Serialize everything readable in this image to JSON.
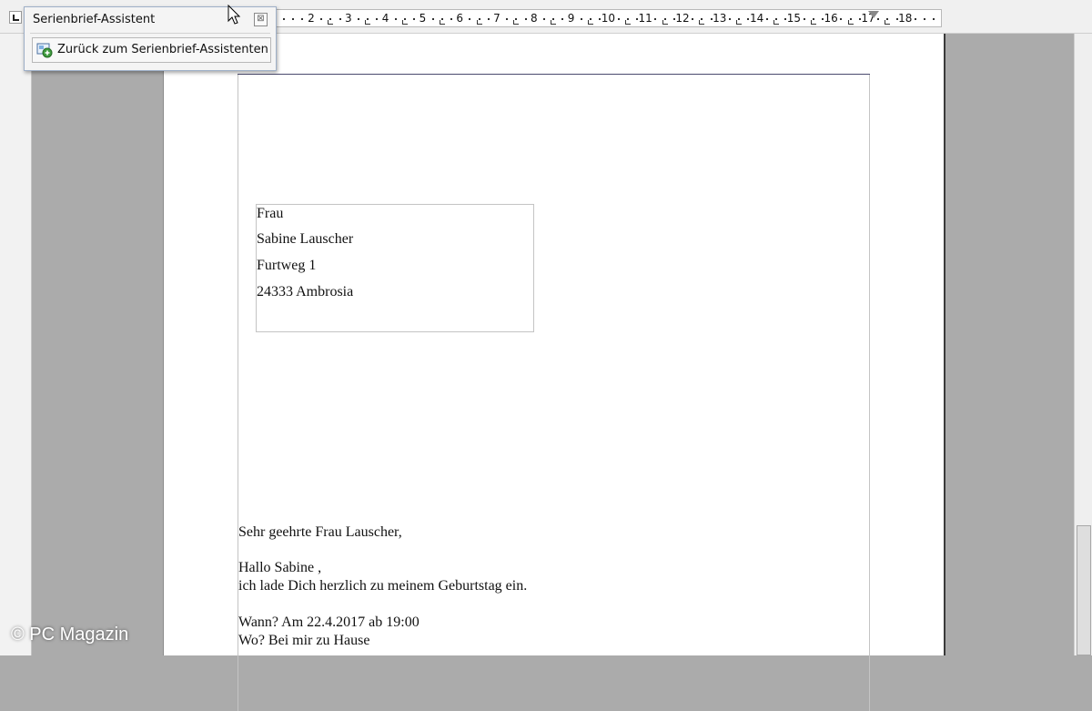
{
  "ruler": {
    "numbers": [
      "2",
      "3",
      "4",
      "5",
      "6",
      "7",
      "8",
      "9",
      "10",
      "11",
      "12",
      "13",
      "14",
      "15",
      "16",
      "17",
      "18"
    ]
  },
  "wizard": {
    "title": "Serienbrief-Assistent",
    "back_button_label": "Zurück zum Serienbrief-Assistenten",
    "close_glyph": "⊠"
  },
  "letter": {
    "address": [
      "Frau",
      "Sabine Lauscher",
      "Furtweg 1",
      "24333 Ambrosia"
    ],
    "salutation": "Sehr geehrte Frau Lauscher,",
    "greeting": "Hallo Sabine ,",
    "invite": "ich lade Dich herzlich zu meinem Geburtstag ein.",
    "when": "Wann? Am 22.4.2017 ab 19:00",
    "where": "Wo? Bei mir zu Hause"
  },
  "watermark": "© PC Magazin",
  "colors": {
    "page": "#ffffff",
    "workspace": "#ababab",
    "toolbar_border": "#9fb0c8"
  }
}
